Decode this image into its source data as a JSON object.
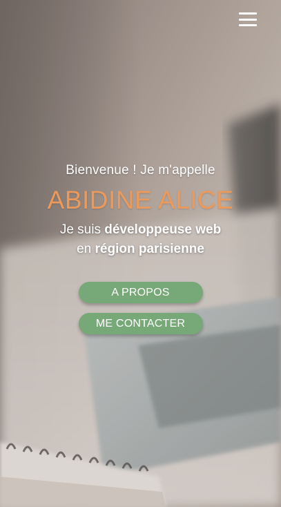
{
  "header": {
    "menu_icon": "hamburger-menu-icon"
  },
  "hero": {
    "welcome": "Bienvenue ! Je m'appelle",
    "name": "ABIDINE ALICE",
    "line1_prefix": "Je suis ",
    "line1_strong": "développeuse web",
    "line2_prefix": "en ",
    "line2_strong": "région parisienne"
  },
  "buttons": {
    "about_label": "A PROPOS",
    "contact_label": "ME CONTACTER"
  },
  "colors": {
    "accent_name": "#ec9a5b",
    "button_green": "#77a877",
    "text": "#ffffff"
  }
}
